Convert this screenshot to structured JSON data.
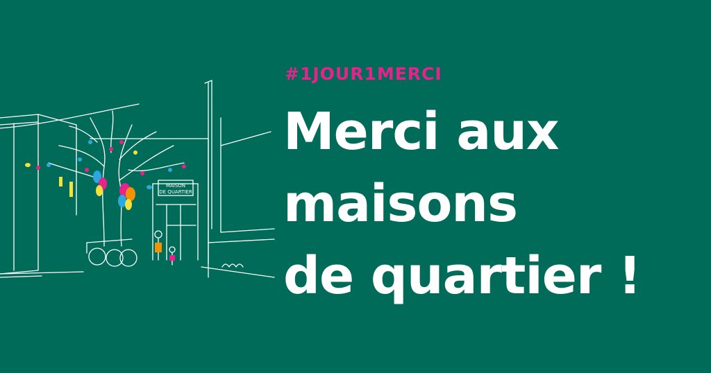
{
  "hashtag": "#1JOUR1MERCI",
  "headline": {
    "line1": "Merci aux",
    "line2": "maisons",
    "line3": "de quartier !"
  },
  "illustration": {
    "sign_line1": "MAISON",
    "sign_line2": "DE QUARTIER"
  },
  "colors": {
    "background": "#006b58",
    "accent": "#e6238a",
    "text": "#ffffff"
  }
}
